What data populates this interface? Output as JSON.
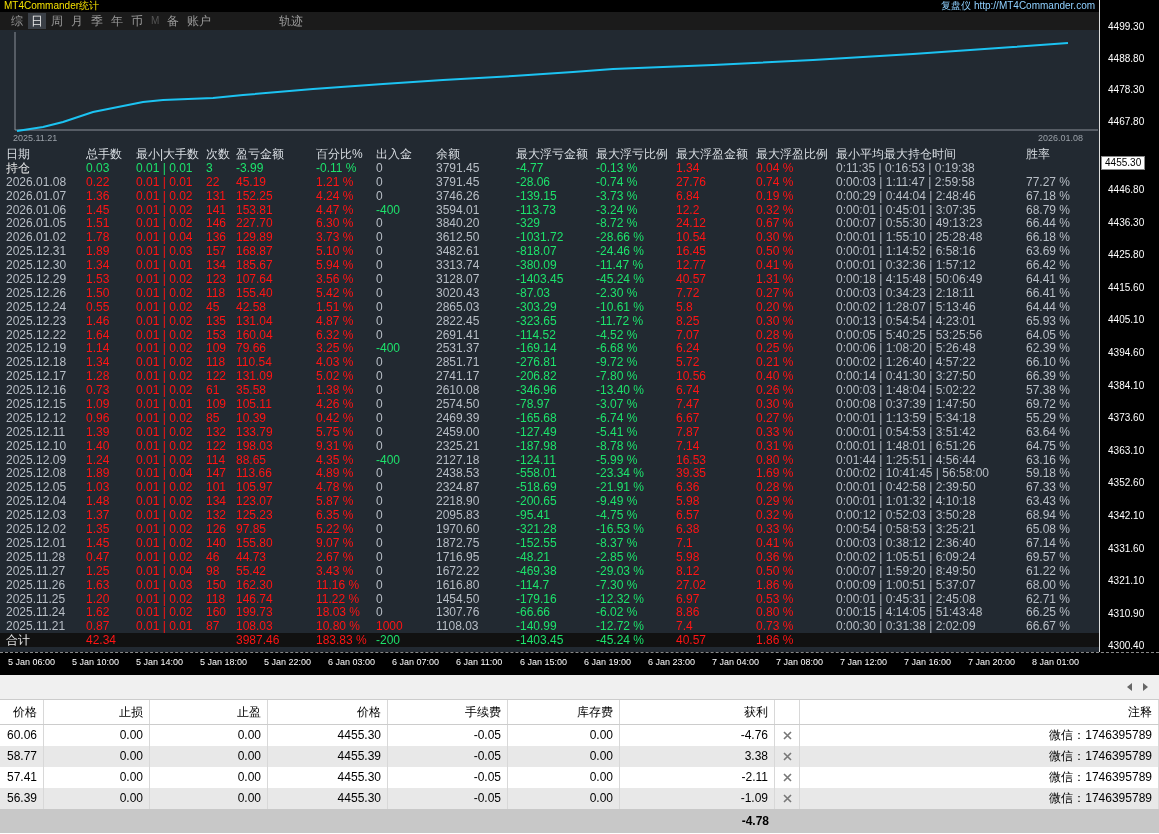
{
  "title_bar": {
    "title": "MT4Commander统计",
    "link": "复盘仪 http://MT4Commander.com"
  },
  "tabs": [
    {
      "label": "综",
      "selected": false,
      "disabled": false
    },
    {
      "label": "日",
      "selected": true,
      "disabled": false
    },
    {
      "label": "周",
      "selected": false,
      "disabled": false
    },
    {
      "label": "月",
      "selected": false,
      "disabled": false
    },
    {
      "label": "季",
      "selected": false,
      "disabled": false
    },
    {
      "label": "年",
      "selected": false,
      "disabled": false
    },
    {
      "label": "币",
      "selected": false,
      "disabled": false
    },
    {
      "label": "M",
      "selected": false,
      "disabled": true
    },
    {
      "label": "备",
      "selected": false,
      "disabled": false
    },
    {
      "label": "账户",
      "selected": false,
      "disabled": false
    }
  ],
  "trail_tab": {
    "label": "轨迹",
    "selected": false
  },
  "equity_chart": {
    "start_label": "2025.11.21",
    "end_label": "2026.01.08"
  },
  "stats_table": {
    "columns": [
      "日期",
      "总手数",
      "最小|大手数",
      "次数",
      "盈亏金额",
      "百分比%",
      "出入金",
      "余额",
      "最大浮亏金额",
      "最大浮亏比例",
      "最大浮盈金额",
      "最大浮盈比例",
      "最小平均最大持仓时间",
      "胜率"
    ],
    "rows": [
      {
        "kind": "holding",
        "cells": [
          "持仓",
          "0.03",
          "0.01 | 0.01",
          "3",
          "-3.99",
          "-0.11 %",
          "0",
          "3791.45",
          "-4.77",
          "-0.13 %",
          "1.34",
          "0.04 %",
          "0:11:35 | 0:16:53 | 0:19:38"
        ]
      },
      {
        "kind": "day",
        "cells": [
          "2026.01.08",
          "0.22",
          "0.01 | 0.01",
          "22",
          "45.19",
          "1.21 %",
          "0",
          "3791.45",
          "-28.06",
          "-0.74 %",
          "27.76",
          "0.74 %",
          "0:00:03 | 1:11:47 | 2:59:58",
          "77.27 %"
        ]
      },
      {
        "kind": "day",
        "cells": [
          "2026.01.07",
          "1.36",
          "0.01 | 0.02",
          "131",
          "152.25",
          "4.24 %",
          "0",
          "3746.26",
          "-139.15",
          "-3.73 %",
          "6.84",
          "0.19 %",
          "0:00:29 | 0:44:04 | 2:48:46",
          "67.18 %"
        ]
      },
      {
        "kind": "withdrawal",
        "cells": [
          "2026.01.06",
          "1.45",
          "0.01 | 0.02",
          "141",
          "153.81",
          "4.47 %",
          "-400",
          "3594.01",
          "-113.73",
          "-3.24 %",
          "12.2",
          "0.32 %",
          "0:00:01 | 0:45:01 | 3:07:35",
          "68.79 %"
        ]
      },
      {
        "kind": "day",
        "cells": [
          "2026.01.05",
          "1.51",
          "0.01 | 0.02",
          "146",
          "227.70",
          "6.30 %",
          "0",
          "3840.20",
          "-329",
          "-8.72 %",
          "24.12",
          "0.67 %",
          "0:00:07 | 0:55:30 | 49:13:23",
          "66.44 %"
        ]
      },
      {
        "kind": "day",
        "cells": [
          "2026.01.02",
          "1.78",
          "0.01 | 0.04",
          "136",
          "129.89",
          "3.73 %",
          "0",
          "3612.50",
          "-1031.72",
          "-28.66 %",
          "10.54",
          "0.30 %",
          "0:00:01 | 1:55:10 | 25:28:48",
          "66.18 %"
        ]
      },
      {
        "kind": "day",
        "cells": [
          "2025.12.31",
          "1.89",
          "0.01 | 0.03",
          "157",
          "168.87",
          "5.10 %",
          "0",
          "3482.61",
          "-818.07",
          "-24.46 %",
          "16.45",
          "0.50 %",
          "0:00:01 | 1:14:52 | 6:58:16",
          "63.69 %"
        ]
      },
      {
        "kind": "day",
        "cells": [
          "2025.12.30",
          "1.34",
          "0.01 | 0.01",
          "134",
          "185.67",
          "5.94 %",
          "0",
          "3313.74",
          "-380.09",
          "-11.47 %",
          "12.77",
          "0.41 %",
          "0:00:01 | 0:32:36 | 1:57:12",
          "66.42 %"
        ]
      },
      {
        "kind": "day",
        "cells": [
          "2025.12.29",
          "1.53",
          "0.01 | 0.02",
          "123",
          "107.64",
          "3.56 %",
          "0",
          "3128.07",
          "-1403.45",
          "-45.24 %",
          "40.57",
          "1.31 %",
          "0:00:18 | 4:15:48 | 50:06:49",
          "64.41 %"
        ]
      },
      {
        "kind": "day",
        "cells": [
          "2025.12.26",
          "1.50",
          "0.01 | 0.02",
          "118",
          "155.40",
          "5.42 %",
          "0",
          "3020.43",
          "-87.03",
          "-2.30 %",
          "7.72",
          "0.27 %",
          "0:00:03 | 0:34:23 | 2:18:11",
          "66.41 %"
        ]
      },
      {
        "kind": "day",
        "cells": [
          "2025.12.24",
          "0.55",
          "0.01 | 0.02",
          "45",
          "42.58",
          "1.51 %",
          "0",
          "2865.03",
          "-303.29",
          "-10.61 %",
          "5.8",
          "0.20 %",
          "0:00:02 | 1:28:07 | 5:13:46",
          "64.44 %"
        ]
      },
      {
        "kind": "day",
        "cells": [
          "2025.12.23",
          "1.46",
          "0.01 | 0.02",
          "135",
          "131.04",
          "4.87 %",
          "0",
          "2822.45",
          "-323.65",
          "-11.72 %",
          "8.25",
          "0.30 %",
          "0:00:13 | 0:54:54 | 4:23:01",
          "65.93 %"
        ]
      },
      {
        "kind": "day",
        "cells": [
          "2025.12.22",
          "1.64",
          "0.01 | 0.02",
          "153",
          "160.04",
          "6.32 %",
          "0",
          "2691.41",
          "-114.52",
          "-4.52 %",
          "7.07",
          "0.28 %",
          "0:00:05 | 5:40:25 | 53:25:56",
          "64.05 %"
        ]
      },
      {
        "kind": "withdrawal",
        "cells": [
          "2025.12.19",
          "1.14",
          "0.01 | 0.02",
          "109",
          "79.66",
          "3.25 %",
          "-400",
          "2531.37",
          "-169.14",
          "-6.68 %",
          "6.24",
          "0.25 %",
          "0:00:06 | 1:08:20 | 5:26:48",
          "62.39 %"
        ]
      },
      {
        "kind": "day",
        "cells": [
          "2025.12.18",
          "1.34",
          "0.01 | 0.02",
          "118",
          "110.54",
          "4.03 %",
          "0",
          "2851.71",
          "-276.81",
          "-9.72 %",
          "5.72",
          "0.21 %",
          "0:00:02 | 1:26:40 | 4:57:22",
          "66.10 %"
        ]
      },
      {
        "kind": "day",
        "cells": [
          "2025.12.17",
          "1.28",
          "0.01 | 0.02",
          "122",
          "131.09",
          "5.02 %",
          "0",
          "2741.17",
          "-206.82",
          "-7.80 %",
          "10.56",
          "0.40 %",
          "0:00:14 | 0:41:30 | 3:27:50",
          "66.39 %"
        ]
      },
      {
        "kind": "day",
        "cells": [
          "2025.12.16",
          "0.73",
          "0.01 | 0.02",
          "61",
          "35.58",
          "1.38 %",
          "0",
          "2610.08",
          "-346.96",
          "-13.40 %",
          "6.74",
          "0.26 %",
          "0:00:03 | 1:48:04 | 5:02:22",
          "57.38 %"
        ]
      },
      {
        "kind": "day",
        "cells": [
          "2025.12.15",
          "1.09",
          "0.01 | 0.01",
          "109",
          "105.11",
          "4.26 %",
          "0",
          "2574.50",
          "-78.97",
          "-3.07 %",
          "7.47",
          "0.30 %",
          "0:00:08 | 0:37:39 | 1:47:50",
          "69.72 %"
        ]
      },
      {
        "kind": "day",
        "cells": [
          "2025.12.12",
          "0.96",
          "0.01 | 0.02",
          "85",
          "10.39",
          "0.42 %",
          "0",
          "2469.39",
          "-165.68",
          "-6.74 %",
          "6.67",
          "0.27 %",
          "0:00:01 | 1:13:59 | 5:34:18",
          "55.29 %"
        ]
      },
      {
        "kind": "day",
        "cells": [
          "2025.12.11",
          "1.39",
          "0.01 | 0.02",
          "132",
          "133.79",
          "5.75 %",
          "0",
          "2459.00",
          "-127.49",
          "-5.41 %",
          "7.87",
          "0.33 %",
          "0:00:01 | 0:54:53 | 3:51:42",
          "63.64 %"
        ]
      },
      {
        "kind": "day",
        "cells": [
          "2025.12.10",
          "1.40",
          "0.01 | 0.02",
          "122",
          "198.03",
          "9.31 %",
          "0",
          "2325.21",
          "-187.98",
          "-8.78 %",
          "7.14",
          "0.31 %",
          "0:00:01 | 1:48:01 | 6:51:26",
          "64.75 %"
        ]
      },
      {
        "kind": "withdrawal",
        "cells": [
          "2025.12.09",
          "1.24",
          "0.01 | 0.02",
          "114",
          "88.65",
          "4.35 %",
          "-400",
          "2127.18",
          "-124.11",
          "-5.99 %",
          "16.53",
          "0.80 %",
          "0:01:44 | 1:25:51 | 4:56:44",
          "63.16 %"
        ]
      },
      {
        "kind": "day",
        "cells": [
          "2025.12.08",
          "1.89",
          "0.01 | 0.04",
          "147",
          "113.66",
          "4.89 %",
          "0",
          "2438.53",
          "-558.01",
          "-23.34 %",
          "39.35",
          "1.69 %",
          "0:00:02 | 10:41:45 | 56:58:00",
          "59.18 %"
        ]
      },
      {
        "kind": "day",
        "cells": [
          "2025.12.05",
          "1.03",
          "0.01 | 0.02",
          "101",
          "105.97",
          "4.78 %",
          "0",
          "2324.87",
          "-518.69",
          "-21.91 %",
          "6.36",
          "0.28 %",
          "0:00:01 | 0:42:58 | 2:39:50",
          "67.33 %"
        ]
      },
      {
        "kind": "day",
        "cells": [
          "2025.12.04",
          "1.48",
          "0.01 | 0.02",
          "134",
          "123.07",
          "5.87 %",
          "0",
          "2218.90",
          "-200.65",
          "-9.49 %",
          "5.98",
          "0.29 %",
          "0:00:01 | 1:01:32 | 4:10:18",
          "63.43 %"
        ]
      },
      {
        "kind": "day",
        "cells": [
          "2025.12.03",
          "1.37",
          "0.01 | 0.02",
          "132",
          "125.23",
          "6.35 %",
          "0",
          "2095.83",
          "-95.41",
          "-4.75 %",
          "6.57",
          "0.32 %",
          "0:00:12 | 0:52:03 | 3:50:28",
          "68.94 %"
        ]
      },
      {
        "kind": "day",
        "cells": [
          "2025.12.02",
          "1.35",
          "0.01 | 0.02",
          "126",
          "97.85",
          "5.22 %",
          "0",
          "1970.60",
          "-321.28",
          "-16.53 %",
          "6.38",
          "0.33 %",
          "0:00:54 | 0:58:53 | 3:25:21",
          "65.08 %"
        ]
      },
      {
        "kind": "day",
        "cells": [
          "2025.12.01",
          "1.45",
          "0.01 | 0.02",
          "140",
          "155.80",
          "9.07 %",
          "0",
          "1872.75",
          "-152.55",
          "-8.37 %",
          "7.1",
          "0.41 %",
          "0:00:03 | 0:38:12 | 2:36:40",
          "67.14 %"
        ]
      },
      {
        "kind": "day",
        "cells": [
          "2025.11.28",
          "0.47",
          "0.01 | 0.02",
          "46",
          "44.73",
          "2.67 %",
          "0",
          "1716.95",
          "-48.21",
          "-2.85 %",
          "5.98",
          "0.36 %",
          "0:00:02 | 1:05:51 | 6:09:24",
          "69.57 %"
        ]
      },
      {
        "kind": "day",
        "cells": [
          "2025.11.27",
          "1.25",
          "0.01 | 0.04",
          "98",
          "55.42",
          "3.43 %",
          "0",
          "1672.22",
          "-469.38",
          "-29.03 %",
          "8.12",
          "0.50 %",
          "0:00:07 | 1:59:20 | 8:49:50",
          "61.22 %"
        ]
      },
      {
        "kind": "day",
        "cells": [
          "2025.11.26",
          "1.63",
          "0.01 | 0.03",
          "150",
          "162.30",
          "11.16 %",
          "0",
          "1616.80",
          "-114.7",
          "-7.30 %",
          "27.02",
          "1.86 %",
          "0:00:09 | 1:00:51 | 5:37:07",
          "68.00 %"
        ]
      },
      {
        "kind": "day",
        "cells": [
          "2025.11.25",
          "1.20",
          "0.01 | 0.02",
          "118",
          "146.74",
          "11.22 %",
          "0",
          "1454.50",
          "-179.16",
          "-12.32 %",
          "6.97",
          "0.53 %",
          "0:00:01 | 0:45:31 | 2:45:08",
          "62.71 %"
        ]
      },
      {
        "kind": "day",
        "cells": [
          "2025.11.24",
          "1.62",
          "0.01 | 0.02",
          "160",
          "199.73",
          "18.03 %",
          "0",
          "1307.76",
          "-66.66",
          "-6.02 %",
          "8.86",
          "0.80 %",
          "0:00:15 | 4:14:05 | 51:43:48",
          "66.25 %"
        ]
      },
      {
        "kind": "deposit",
        "cells": [
          "2025.11.21",
          "0.87",
          "0.01 | 0.01",
          "87",
          "108.03",
          "10.80 %",
          "1000",
          "1108.03",
          "-140.99",
          "-12.72 %",
          "7.4",
          "0.73 %",
          "0:00:30 | 0:31:38 | 2:02:09",
          "66.67 %"
        ]
      }
    ],
    "total": {
      "label": "合计",
      "lots": "42.34",
      "pl": "3987.46",
      "pct": "183.83 %",
      "io": "-200",
      "max_loss": "-1403.45",
      "max_loss_pct": "-45.24 %",
      "max_profit": "40.57",
      "max_profit_pct": "1.86 %"
    }
  },
  "price_axis": {
    "ticks": [
      "4499.30",
      "4488.80",
      "4478.30",
      "4467.80",
      "4446.80",
      "4436.30",
      "4425.80",
      "4415.60",
      "4405.10",
      "4394.60",
      "4384.10",
      "4373.60",
      "4363.10",
      "4352.60",
      "4342.10",
      "4331.60",
      "4321.10",
      "4310.90",
      "4300.40"
    ],
    "current_price": "4455.30"
  },
  "time_axis": [
    "5 Jan 06:00",
    "5 Jan 10:00",
    "5 Jan 14:00",
    "5 Jan 18:00",
    "5 Jan 22:00",
    "6 Jan 03:00",
    "6 Jan 07:00",
    "6 Jan 11:00",
    "6 Jan 15:00",
    "6 Jan 19:00",
    "6 Jan 23:00",
    "7 Jan 04:00",
    "7 Jan 08:00",
    "7 Jan 12:00",
    "7 Jan 16:00",
    "7 Jan 20:00",
    "8 Jan 01:00"
  ],
  "orders": {
    "columns": [
      "价格",
      "止损",
      "止盈",
      "价格",
      "手续费",
      "库存费",
      "获利",
      "注释"
    ],
    "rows": [
      {
        "cells": [
          "60.06",
          "0.00",
          "0.00",
          "4455.30",
          "-0.05",
          "0.00",
          "-4.76"
        ],
        "comment": "微信：1746395789"
      },
      {
        "cells": [
          "58.77",
          "0.00",
          "0.00",
          "4455.39",
          "-0.05",
          "0.00",
          "3.38"
        ],
        "comment": "微信：1746395789"
      },
      {
        "cells": [
          "57.41",
          "0.00",
          "0.00",
          "4455.30",
          "-0.05",
          "0.00",
          "-2.11"
        ],
        "comment": "微信：1746395789"
      },
      {
        "cells": [
          "56.39",
          "0.00",
          "0.00",
          "4455.30",
          "-0.05",
          "0.00",
          "-1.09"
        ],
        "comment": "微信：1746395789"
      }
    ],
    "total_profit": "-4.78"
  }
}
